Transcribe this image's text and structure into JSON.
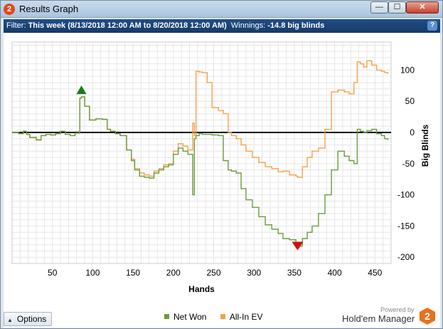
{
  "window": {
    "title": "Results Graph",
    "app_icon": "2",
    "buttons": {
      "minimize": "—",
      "maximize": "☐",
      "close": "✕"
    }
  },
  "filter": {
    "prefix": "Filter: ",
    "range": "This week (8/13/2018 12:00 AM to 8/20/2018 12:00 AM)",
    "winnings_label": "  Winnings: ",
    "winnings_value": "-14.8 big blinds",
    "help": "?"
  },
  "footer": {
    "options_label": "Options",
    "powered_by": "Powered by",
    "brand": "Hold'em Manager",
    "brand_logo": "2"
  },
  "colors": {
    "net_won": "#6a9b3c",
    "all_in_ev": "#f4a14a",
    "zero_line": "#000000",
    "max_marker": "#1a7a1a",
    "min_marker": "#d01010"
  },
  "chart_data": {
    "type": "line",
    "xlabel": "Hands",
    "ylabel": "Big Blinds",
    "xlim": [
      0,
      470
    ],
    "ylim": [
      -210,
      145
    ],
    "x_ticks": [
      50,
      100,
      150,
      200,
      250,
      300,
      350,
      400,
      450
    ],
    "y_ticks": [
      100,
      50,
      0,
      -50,
      -100,
      -150,
      -200
    ],
    "grid": true,
    "legend_position": "bottom",
    "series": [
      {
        "name": "Net Won",
        "x": [
          0,
          8,
          14,
          18,
          22,
          30,
          36,
          42,
          48,
          54,
          60,
          66,
          72,
          78,
          84,
          86,
          90,
          96,
          104,
          112,
          118,
          122,
          128,
          134,
          142,
          148,
          152,
          158,
          164,
          170,
          176,
          182,
          188,
          194,
          200,
          206,
          212,
          218,
          224,
          226,
          228,
          232,
          236,
          242,
          248,
          256,
          262,
          268,
          272,
          278,
          284,
          290,
          298,
          306,
          314,
          322,
          330,
          336,
          344,
          352,
          354,
          360,
          366,
          372,
          380,
          388,
          396,
          404,
          412,
          418,
          424,
          428,
          432,
          436,
          440,
          446,
          452,
          458,
          462,
          466
        ],
        "values": [
          0,
          -2,
          2,
          -3,
          -8,
          -12,
          -5,
          -3,
          -4,
          -2,
          2,
          -3,
          -5,
          -1,
          55,
          57,
          42,
          20,
          22,
          21,
          5,
          2,
          -2,
          -5,
          -28,
          -45,
          -60,
          -70,
          -72,
          -73,
          -65,
          -60,
          -55,
          -52,
          -35,
          -25,
          -30,
          -35,
          -100,
          -10,
          -5,
          -2,
          -3,
          -3,
          -4,
          -5,
          -45,
          -60,
          -62,
          -65,
          -90,
          -108,
          -120,
          -135,
          -148,
          -155,
          -162,
          -170,
          -172,
          -178,
          -182,
          -170,
          -160,
          -150,
          -130,
          -100,
          -60,
          -30,
          -38,
          -45,
          -50,
          5,
          2,
          0,
          3,
          5,
          -2,
          -5,
          -10,
          -12
        ]
      },
      {
        "name": "All-In EV",
        "x": [
          0,
          8,
          14,
          18,
          22,
          30,
          36,
          42,
          48,
          54,
          60,
          66,
          72,
          78,
          84,
          86,
          90,
          96,
          104,
          112,
          118,
          122,
          128,
          134,
          142,
          148,
          152,
          158,
          164,
          170,
          176,
          182,
          188,
          194,
          200,
          206,
          212,
          218,
          224,
          226,
          228,
          232,
          236,
          242,
          248,
          256,
          262,
          268,
          272,
          278,
          284,
          290,
          298,
          306,
          314,
          322,
          330,
          336,
          344,
          352,
          354,
          360,
          366,
          372,
          380,
          388,
          396,
          404,
          412,
          418,
          424,
          428,
          432,
          436,
          440,
          446,
          452,
          458,
          462,
          466
        ],
        "values": [
          0,
          -2,
          2,
          -3,
          -8,
          -12,
          -5,
          -3,
          -4,
          -2,
          2,
          -3,
          -5,
          -1,
          55,
          57,
          42,
          20,
          22,
          21,
          5,
          2,
          -2,
          -5,
          -28,
          -43,
          -58,
          -65,
          -68,
          -70,
          -62,
          -58,
          -52,
          -50,
          -30,
          -18,
          -22,
          -28,
          15,
          -5,
          98,
          97,
          96,
          80,
          40,
          35,
          30,
          0,
          -5,
          -10,
          -20,
          -30,
          -40,
          -48,
          -55,
          -58,
          -63,
          -62,
          -68,
          -70,
          -72,
          -55,
          -40,
          -30,
          -25,
          5,
          65,
          68,
          65,
          62,
          80,
          113,
          110,
          105,
          115,
          108,
          100,
          98,
          96,
          94
        ]
      }
    ],
    "annotations": [
      {
        "label": "max",
        "x": 86,
        "y": 57
      },
      {
        "label": "min",
        "x": 354,
        "y": -182
      }
    ]
  }
}
